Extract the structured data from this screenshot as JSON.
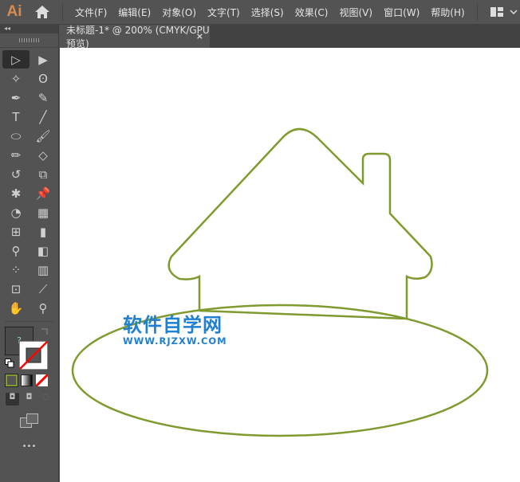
{
  "app": {
    "logo": "Ai"
  },
  "menu": [
    "文件(F)",
    "编辑(E)",
    "对象(O)",
    "文字(T)",
    "选择(S)",
    "效果(C)",
    "视图(V)",
    "窗口(W)",
    "帮助(H)"
  ],
  "document_tab": {
    "title": "未标题-1* @ 200% (CMYK/GPU 预览)",
    "close": "×"
  },
  "toolbar": {
    "collapse": "◂◂",
    "more": "•••",
    "tools": [
      "selection-tool",
      "direct-selection-tool",
      "magic-wand-tool",
      "lasso-tool",
      "pen-tool",
      "curvature-tool",
      "type-tool",
      "line-tool",
      "ellipse-tool",
      "paintbrush-tool",
      "pencil-tool",
      "eraser-tool",
      "rotate-tool",
      "scale-tool",
      "puppet-warp-tool",
      "pin-tool",
      "shape-builder-tool",
      "perspective-grid-tool",
      "mesh-tool",
      "gradient-tool",
      "eyedropper-tool",
      "blend-tool",
      "symbol-sprayer-tool",
      "graph-tool",
      "artboard-tool",
      "slice-tool",
      "hand-tool",
      "zoom-tool"
    ],
    "fill_color": "#ffffff",
    "stroke": "none"
  },
  "artwork": {
    "stroke_color": "#7f9a2e"
  },
  "watermark": {
    "cn": "软件自学网",
    "en": "WWW.RJZXW.COM"
  }
}
